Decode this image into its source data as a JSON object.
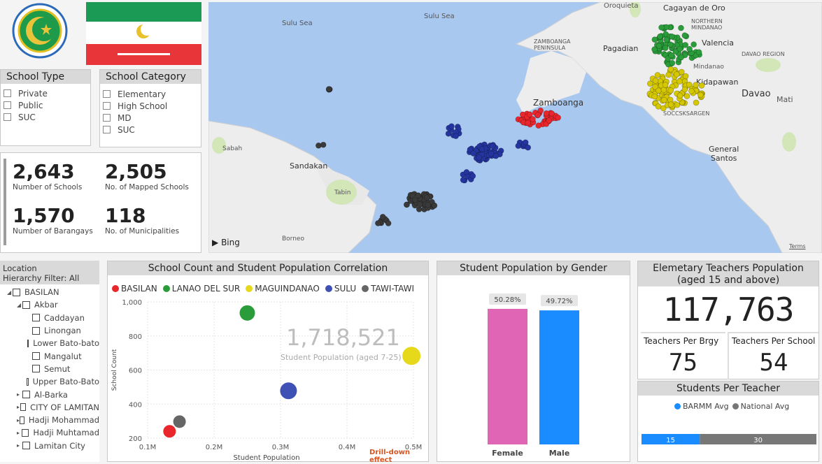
{
  "map": {
    "labels": {
      "sulu_sea_1": "Sulu Sea",
      "sulu_sea_2": "Sulu Sea",
      "oroquieta": "Oroquieta",
      "cagayan": "Cagayan de Oro",
      "northern_mindanao": "NORTHERN\nMINDANAO",
      "zamboanga_pen": "ZAMBOANGA\nPENINSULA",
      "pagadian": "Pagadian",
      "valencia": "Valencia",
      "davao_region": "DAVAO REGION",
      "mindanao": "Mindanao",
      "idapawan": "Kidapawan",
      "davao": "Davao",
      "mati": "Mati",
      "soccsksargen": "SOCCSKSARGEN",
      "zamboanga": "Zamboanga",
      "sabah": "Sabah",
      "sandakan": "Sandakan",
      "tabin": "Tabin",
      "borneo": "Borneo",
      "general_santos": "General\nSantos",
      "bing": "Bing",
      "terms": "Terms"
    }
  },
  "slicers": {
    "school_type": {
      "title": "School Type",
      "items": [
        "Private",
        "Public",
        "SUC"
      ]
    },
    "school_category": {
      "title": "School Category",
      "items": [
        "Elementary",
        "High School",
        "MD",
        "SUC"
      ]
    }
  },
  "kpis": [
    {
      "value": "2,643",
      "label": "Number of Schools"
    },
    {
      "value": "2,505",
      "label": "No. of Mapped Schools"
    },
    {
      "value": "1,570",
      "label": "Number of Barangays"
    },
    {
      "value": "118",
      "label": "No. of Municipalities"
    }
  ],
  "hierarchy": {
    "header1": "Location",
    "header2": "Hierarchy Filter: All",
    "rows": [
      {
        "label": "BASILAN",
        "level": 0,
        "tri": "◢"
      },
      {
        "label": "Akbar",
        "level": 1,
        "tri": "◢"
      },
      {
        "label": "Caddayan",
        "level": 2,
        "tri": ""
      },
      {
        "label": "Linongan",
        "level": 2,
        "tri": ""
      },
      {
        "label": "Lower Bato-bato",
        "level": 2,
        "tri": ""
      },
      {
        "label": "Mangalut",
        "level": 2,
        "tri": ""
      },
      {
        "label": "Semut",
        "level": 2,
        "tri": ""
      },
      {
        "label": "Upper Bato-Bato",
        "level": 2,
        "tri": ""
      },
      {
        "label": "Al-Barka",
        "level": 1,
        "tri": "▸"
      },
      {
        "label": "CITY OF LAMITAN",
        "level": 1,
        "tri": "▸"
      },
      {
        "label": "Hadji Mohammad",
        "level": 1,
        "tri": "▸"
      },
      {
        "label": "Hadji Muhtamad",
        "level": 1,
        "tri": "▸"
      },
      {
        "label": "Lamitan City",
        "level": 1,
        "tri": "▸"
      }
    ]
  },
  "scatter": {
    "title": "School Count and Student Population Correlation",
    "overlay_value": "1,718,521",
    "overlay_label": "Student Population (aged 7-25)",
    "drill_note": "Drill-down effect",
    "chart_data": {
      "type": "scatter",
      "xlabel": "Student Population",
      "ylabel": "School Count",
      "xlim": [
        100000,
        500000
      ],
      "ylim": [
        200,
        1000
      ],
      "x_ticks": [
        "0.1M",
        "0.2M",
        "0.3M",
        "0.4M",
        "0.5M"
      ],
      "y_ticks": [
        "200",
        "400",
        "600",
        "800",
        "1,000"
      ],
      "series": [
        {
          "name": "BASILAN",
          "color": "#e8262b",
          "x": 133000,
          "y": 240
        },
        {
          "name": "LANAO DEL SUR",
          "color": "#2a9d3a",
          "x": 250000,
          "y": 935
        },
        {
          "name": "MAGUINDANAO",
          "color": "#e6d81a",
          "x": 497000,
          "y": 683
        },
        {
          "name": "SULU",
          "color": "#3f51b5",
          "x": 312000,
          "y": 478
        },
        {
          "name": "TAWI-TAWI",
          "color": "#666666",
          "x": 148000,
          "y": 297
        }
      ]
    }
  },
  "gender": {
    "title": "Student Population by Gender",
    "chart_data": {
      "type": "bar",
      "categories": [
        "Female",
        "Male"
      ],
      "values": [
        50.28,
        49.72
      ],
      "data_labels": [
        "50.28%",
        "49.72%"
      ],
      "colors": [
        "#e066b5",
        "#1a8cff"
      ]
    }
  },
  "teachers": {
    "title": "Elemetary Teachers Population\n(aged 15 and above)",
    "total": "117,763",
    "per_brgy_label": "Teachers Per Brgy",
    "per_brgy": "75",
    "per_school_label": "Teachers Per School",
    "per_school": "54"
  },
  "spt": {
    "title": "Students Per Teacher",
    "legend_barmm": "BARMM Avg",
    "legend_national": "National Avg",
    "chart_data": {
      "type": "bar",
      "series": [
        {
          "name": "BARMM Avg",
          "value": 15,
          "color": "#1a8cff"
        },
        {
          "name": "National Avg",
          "value": 30,
          "color": "#777777"
        }
      ],
      "labels": [
        "15",
        "30"
      ]
    }
  }
}
